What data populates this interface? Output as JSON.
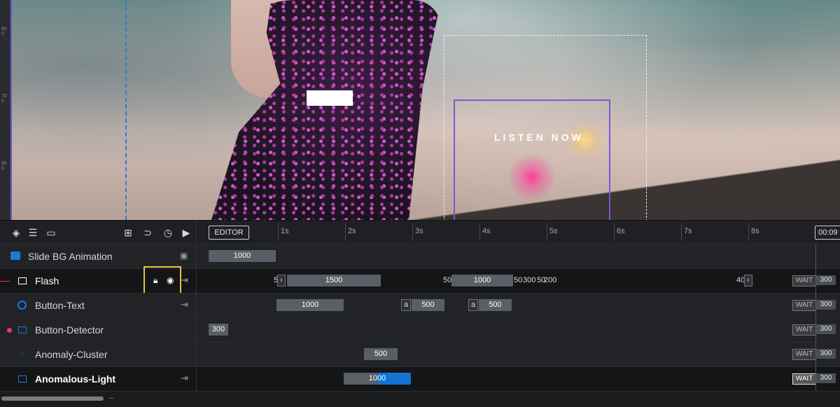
{
  "canvas": {
    "button_text": "LISTEN NOW",
    "ruler_marks": [
      "600",
      "700",
      "800"
    ]
  },
  "toolbar": {
    "icons": [
      "layers-icon",
      "menu-icon",
      "folder-icon",
      "grid-icon",
      "magnet-icon",
      "timer-icon",
      "play-icon"
    ],
    "editor_label": "EDITOR",
    "ticks": [
      "1s",
      "2s",
      "3s",
      "4s",
      "5s",
      "6s",
      "7s",
      "8s"
    ],
    "time": "00:09"
  },
  "layers": [
    {
      "name": "Slide BG Animation",
      "icon": "image-icon",
      "bars": [
        {
          "label": "1000"
        }
      ]
    },
    {
      "name": "Flash",
      "icon": "rectangle-icon",
      "bars": [
        {
          "label": "1500"
        },
        {
          "label": "1000"
        }
      ],
      "minis": [
        "5",
        "50",
        "50",
        "300",
        "50",
        "200",
        "40"
      ],
      "wait": "WAIT",
      "wait_value": "300"
    },
    {
      "name": "Button-Text",
      "icon": "radio-icon",
      "bars": [
        {
          "label": "1000"
        },
        {
          "label": "500"
        },
        {
          "label": "500"
        }
      ],
      "minis": [
        "a",
        "a"
      ],
      "wait": "WAIT",
      "wait_value": "300"
    },
    {
      "name": "Button-Detector",
      "icon": "rectangle-icon",
      "bars": [
        {
          "label": "300"
        }
      ],
      "wait": "WAIT",
      "wait_value": "300"
    },
    {
      "name": "Anomaly-Cluster",
      "icon": "cluster-icon",
      "bars": [
        {
          "label": "500"
        }
      ],
      "wait": "WAIT",
      "wait_value": "300"
    },
    {
      "name": "Anomalous-Light",
      "icon": "rectangle-icon",
      "bars": [
        {
          "label": "1000"
        }
      ],
      "wait": "WAIT",
      "wait_value": "300"
    }
  ]
}
